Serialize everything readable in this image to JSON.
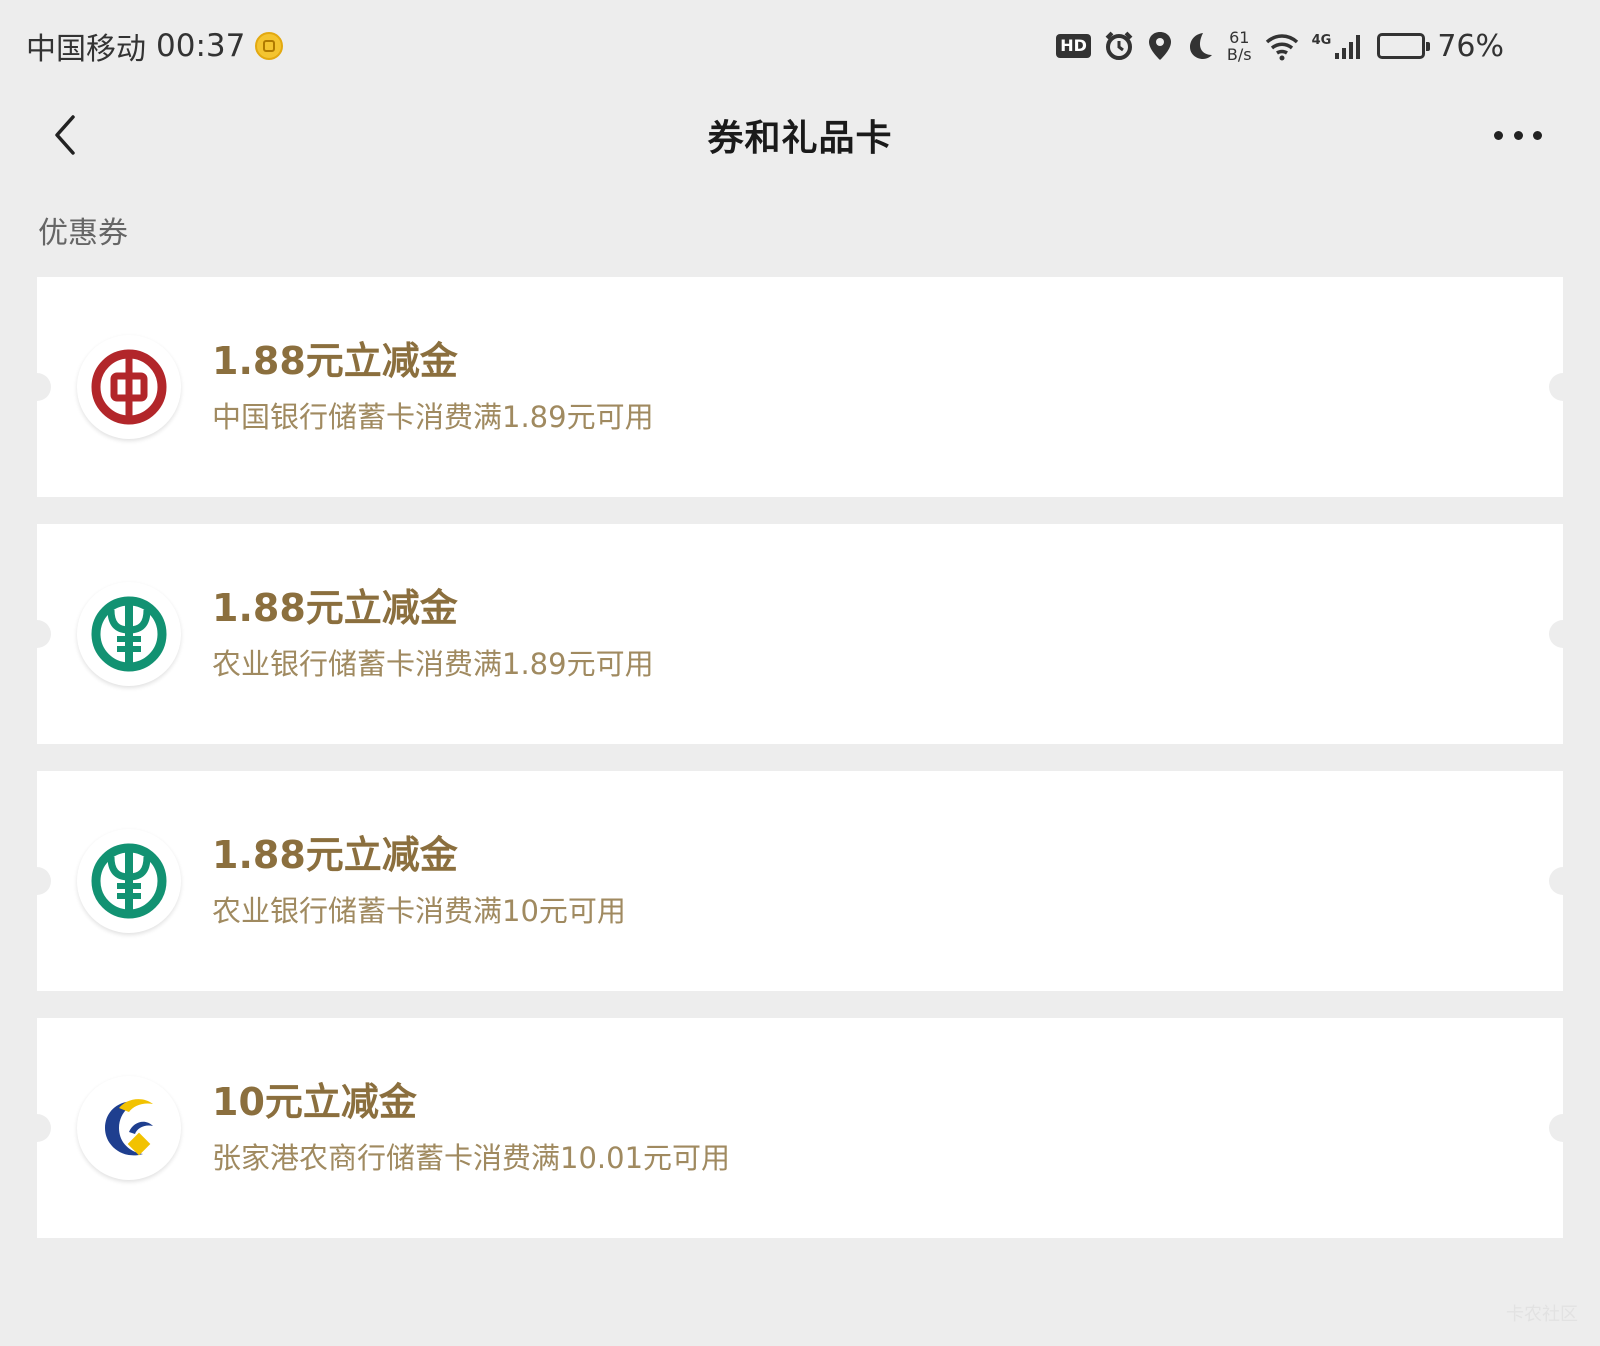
{
  "status_bar": {
    "carrier": "中国移动",
    "time": "00:37",
    "hd_label": "HD",
    "net_speed_value": "61",
    "net_speed_unit": "B/s",
    "network_type": "4G",
    "battery_percent": "76%",
    "battery_level": 0.76
  },
  "nav": {
    "title": "券和礼品卡"
  },
  "section": {
    "label": "优惠券"
  },
  "coupons": [
    {
      "amount": "1.88元立减金",
      "condition": "中国银行储蓄卡消费满1.89元可用",
      "bank_icon": "boc-logo-icon"
    },
    {
      "amount": "1.88元立减金",
      "condition": "农业银行储蓄卡消费满1.89元可用",
      "bank_icon": "abc-logo-icon"
    },
    {
      "amount": "1.88元立减金",
      "condition": "农业银行储蓄卡消费满10元可用",
      "bank_icon": "abc-logo-icon"
    },
    {
      "amount": "10元立减金",
      "condition": "张家港农商行储蓄卡消费满10.01元可用",
      "bank_icon": "zrcb-logo-icon"
    }
  ],
  "watermark": "卡农社区",
  "colors": {
    "background": "#ededed",
    "card": "#ffffff",
    "amount_text": "#8b6f3e",
    "condition_text": "#a08a60",
    "boc_red": "#b2262a",
    "abc_green": "#129272",
    "zrcb_blue": "#1f3f8f",
    "zrcb_yellow": "#f2c200"
  }
}
